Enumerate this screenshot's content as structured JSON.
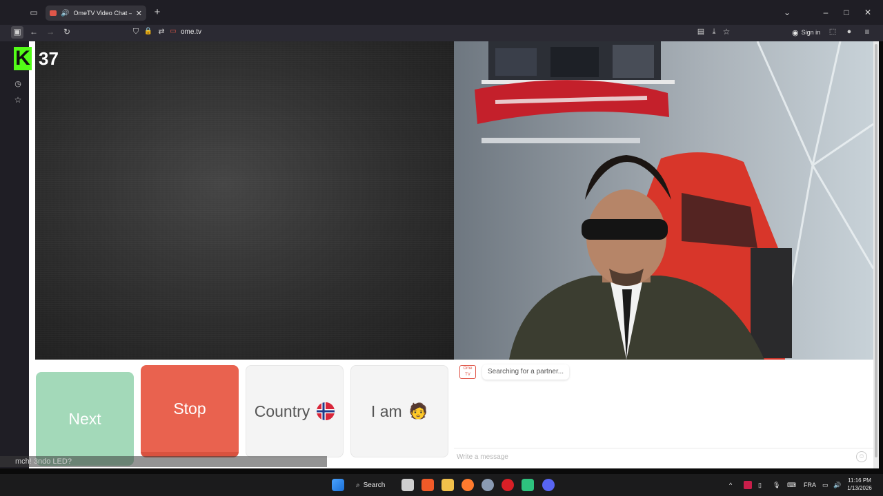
{
  "browser": {
    "tab_title": "OmeTV Video Chat — Ome",
    "url": "ome.tv",
    "sign_in_label": "Sign in",
    "icons": [
      "tab-list-icon",
      "speaker-icon",
      "close-tab-icon",
      "new-tab-icon",
      "list-tabs-icon",
      "minimize-icon",
      "maximize-icon",
      "close-window-icon",
      "sidebar-icon",
      "back-icon",
      "forward-icon",
      "reload-icon",
      "shield-icon",
      "lock-icon",
      "permissions-icon",
      "reader-view-icon",
      "save-page-icon",
      "bookmark-star-icon",
      "account-icon",
      "extensions-icon",
      "sync-icon",
      "menu-icon"
    ]
  },
  "sidebar": {
    "icons": [
      "history-icon",
      "bookmarks-icon"
    ]
  },
  "stream_overlay": {
    "kick_logo": "K",
    "viewer_count": "37",
    "chat_line": "mch! 3ndo LED?"
  },
  "controls": {
    "next_label": "Next",
    "stop_label": "Stop",
    "country_label": "Country",
    "country_flag": "norway-flag",
    "iam_label": "I am",
    "iam_emoji": "🧑"
  },
  "chat": {
    "logo_text": "Ome TV",
    "status_message": "Searching for a partner...",
    "input_placeholder": "Write a message"
  },
  "taskbar": {
    "search_label": "Search",
    "language": "FRA",
    "time": "11:16 PM",
    "date": "1/13/2026"
  },
  "colors": {
    "stop": "#e9624f",
    "next": "#a3d9b9",
    "kick_green": "#53fc18"
  }
}
